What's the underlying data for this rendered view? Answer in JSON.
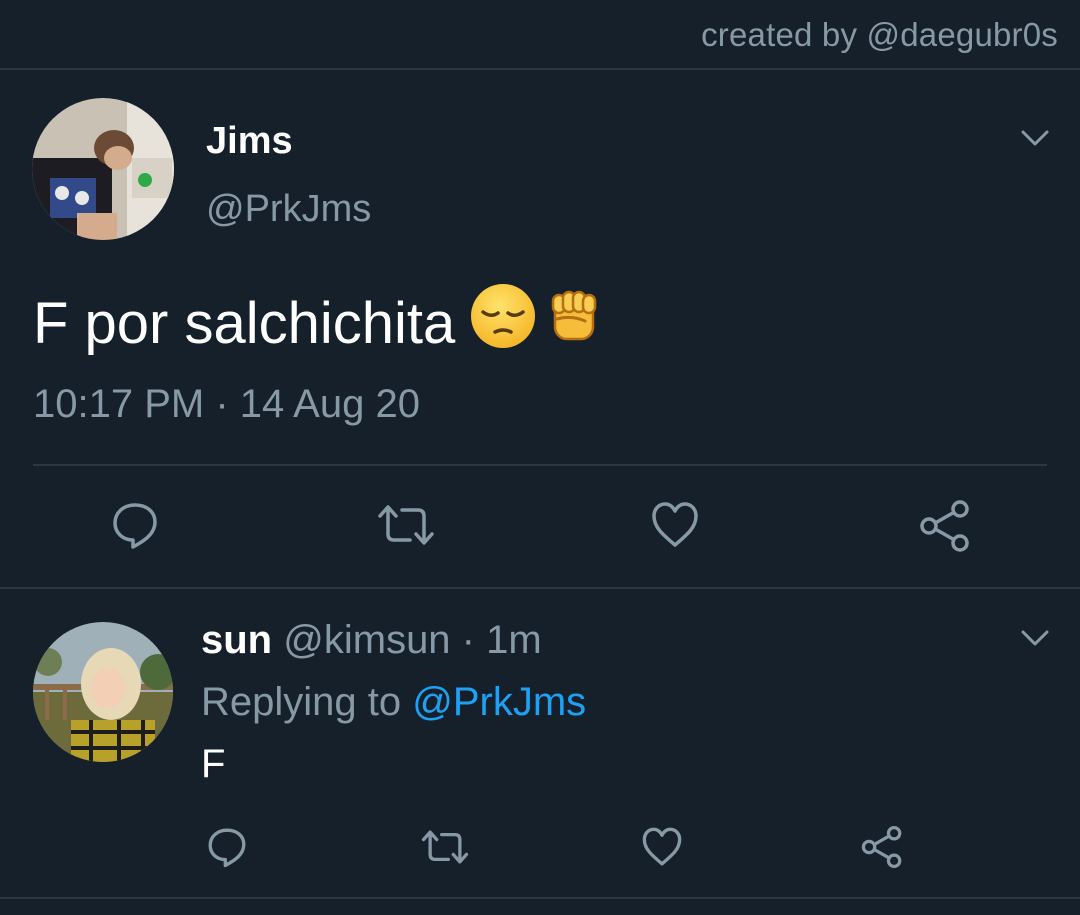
{
  "credit": "created by @daegubr0s",
  "tweet": {
    "display_name": "Jims",
    "handle": "@PrkJms",
    "text": "F por salchichita",
    "emojis": [
      "pensive-face-emoji",
      "raised-fist-emoji"
    ],
    "timestamp": "10:17 PM · 14 Aug 20",
    "actions": [
      "reply",
      "retweet",
      "like",
      "share"
    ]
  },
  "reply": {
    "display_name": "sun",
    "handle_time": "@kimsun · 1m",
    "replying_label": "Replying to",
    "replying_mention": "@PrkJms",
    "text": "F",
    "actions": [
      "reply",
      "retweet",
      "like",
      "share"
    ]
  },
  "colors": {
    "background": "#15202b",
    "secondary_text": "#8899a6",
    "link": "#1da1f2",
    "divider": "#2a3743"
  }
}
